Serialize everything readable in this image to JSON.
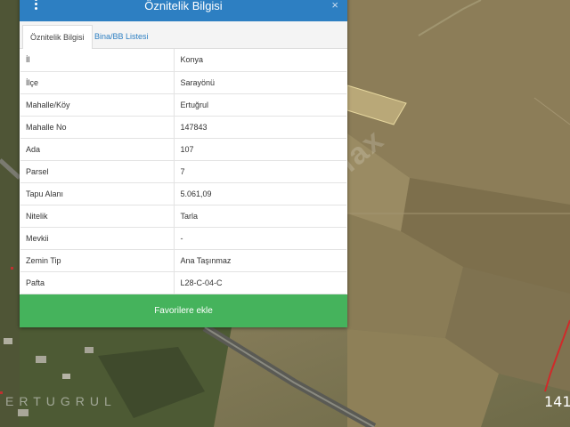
{
  "panel": {
    "title": "Öznitelik Bilgisi",
    "close_symbol": "×",
    "menu_icon": "vertical-dots-icon",
    "tabs": [
      {
        "label": "Öznitelik Bilgisi",
        "active": true
      },
      {
        "label": "Bina/BB Listesi",
        "active": false
      }
    ],
    "rows": [
      {
        "key": "İl",
        "value": "Konya"
      },
      {
        "key": "İlçe",
        "value": "Sarayönü"
      },
      {
        "key": "Mahalle/Köy",
        "value": "Ertuğrul"
      },
      {
        "key": "Mahalle No",
        "value": "147843"
      },
      {
        "key": "Ada",
        "value": "107"
      },
      {
        "key": "Parsel",
        "value": "7"
      },
      {
        "key": "Tapu Alanı",
        "value": "5.061,09"
      },
      {
        "key": "Nitelik",
        "value": "Tarla"
      },
      {
        "key": "Mevkii",
        "value": "-"
      },
      {
        "key": "Zemin Tip",
        "value": "Ana Taşınmaz"
      },
      {
        "key": "Pafta",
        "value": "L28-C-04-C"
      }
    ],
    "favorite_button": "Favorilere ekle"
  },
  "map": {
    "watermark": "lax",
    "brand_text": "ERTUGRUL",
    "corner_label": "141"
  },
  "colors": {
    "header": "#2d7fc2",
    "button": "#45b35c",
    "tab_link": "#2d7fc2"
  }
}
